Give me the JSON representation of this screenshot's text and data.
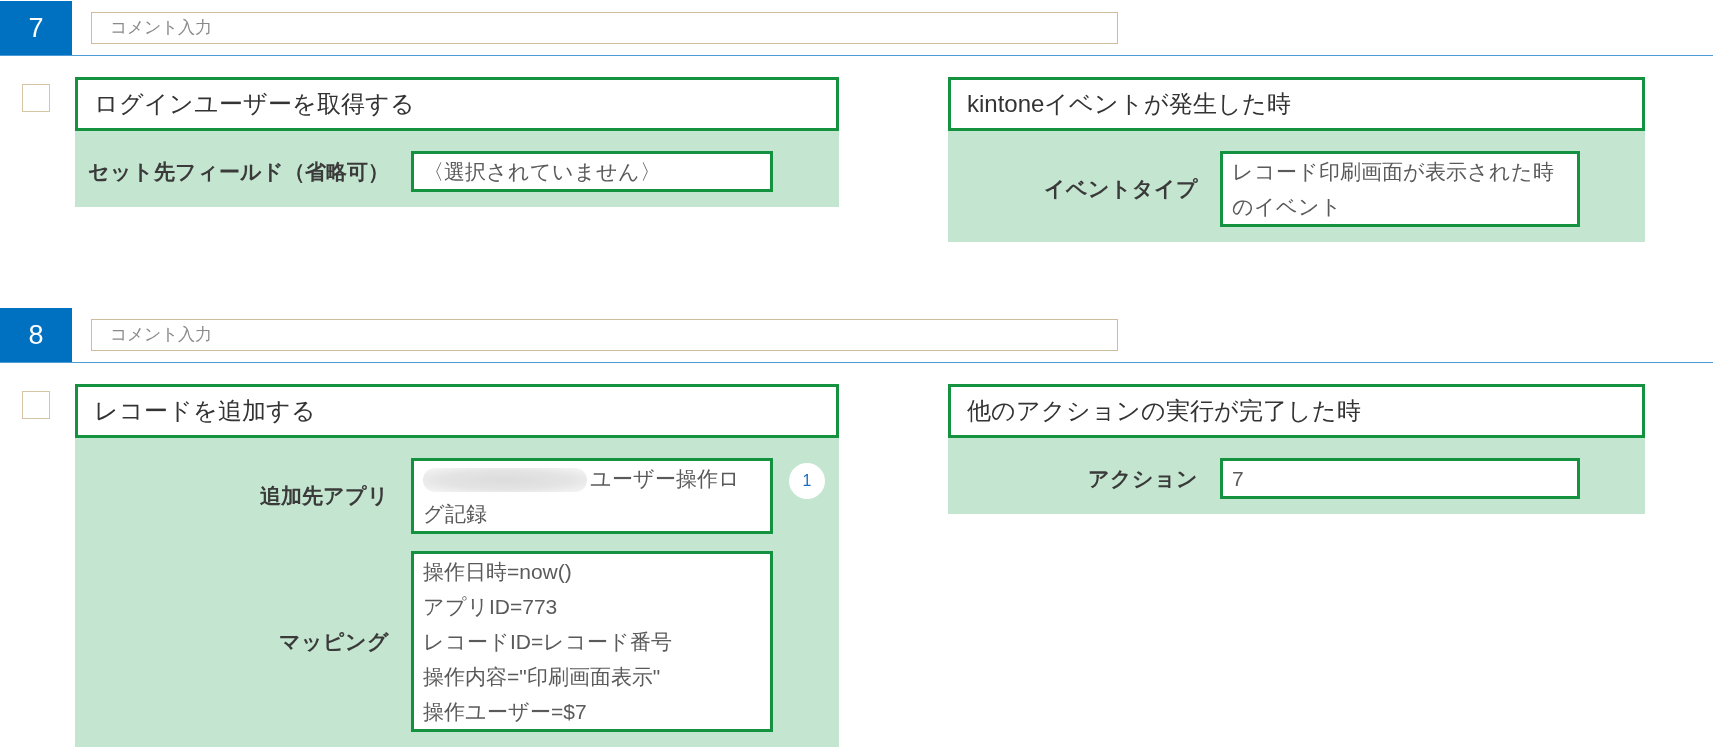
{
  "steps": [
    {
      "number": "7",
      "comment": {
        "placeholder": "コメント入力"
      },
      "checked": false,
      "action": {
        "title": "ログインユーザーを取得する",
        "fields": [
          {
            "label": "セット先フィールド（省略可）",
            "lines": [
              "〈選択されていません〉"
            ]
          }
        ]
      },
      "trigger": {
        "title": "kintoneイベントが発生した時",
        "fields": [
          {
            "label": "イベントタイプ",
            "lines": [
              "レコード印刷画面が表示された時のイベント"
            ]
          }
        ]
      }
    },
    {
      "number": "8",
      "comment": {
        "placeholder": "コメント入力"
      },
      "checked": false,
      "action": {
        "title": "レコードを追加する",
        "fields": [
          {
            "label": "追加先アプリ",
            "blurred_prefix": true,
            "lines": [
              "ユーザー操作ログ記録"
            ],
            "badge": "1"
          },
          {
            "label": "マッピング",
            "lines": [
              "操作日時=now()",
              "アプリID=773",
              "レコードID=レコード番号",
              "操作内容=\"印刷画面表示\"",
              "操作ユーザー=$7"
            ]
          }
        ]
      },
      "trigger": {
        "title": "他のアクションの実行が完了した時",
        "fields": [
          {
            "label": "アクション",
            "lines": [
              "7"
            ]
          }
        ]
      }
    }
  ]
}
